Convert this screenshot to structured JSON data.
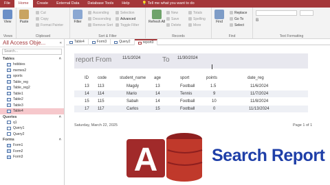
{
  "menubar": {
    "items": [
      "File",
      "Home",
      "Create",
      "External Data",
      "Database Tools",
      "Help"
    ],
    "tell_me": "Tell me what you want to do",
    "colors": {
      "bar": "#a4373a"
    }
  },
  "ribbon": {
    "views": {
      "label": "View",
      "group": "Views"
    },
    "clipboard": {
      "paste": "Paste",
      "cut": "Cut",
      "copy": "Copy",
      "painter": "Format Painter",
      "group": "Clipboard"
    },
    "sort": {
      "filter": "Filter",
      "asc": "Ascending",
      "desc": "Descending",
      "remove": "Remove Sort",
      "selection": "Selection",
      "advanced": "Advanced",
      "toggle": "Toggle Filter",
      "group": "Sort & Filter"
    },
    "records": {
      "refresh": "Refresh All",
      "new": "New",
      "save": "Save",
      "delete": "Delete",
      "totals": "Totals",
      "spelling": "Spelling",
      "more": "More",
      "group": "Records"
    },
    "find": {
      "find": "Find",
      "replace": "Replace",
      "goto": "Go To",
      "select": "Select",
      "group": "Find"
    },
    "text": {
      "group": "Text Formatting"
    }
  },
  "nav": {
    "title": "All Access Obje...",
    "search_placeholder": "Search...",
    "tables_header": "Tables",
    "tables": [
      "hobbies",
      "memes2",
      "sports",
      "Table_reg",
      "Table_reg2",
      "Table1",
      "Table2",
      "Table3",
      "Table4"
    ],
    "queries_header": "Queries",
    "queries": [
      "q1",
      "Query1",
      "Query2"
    ],
    "forms_header": "Forms",
    "forms": [
      "Form1",
      "Form2",
      "Form3"
    ]
  },
  "tabs": [
    "Table4",
    "Form3",
    "Query2",
    "report3"
  ],
  "report": {
    "from_label": "report From",
    "from_value": "11/1/2024",
    "to_label": "To",
    "to_value": "11/30/2024",
    "columns": [
      "ID",
      "code",
      "student_name",
      "age",
      "sport",
      "points",
      "date_reg"
    ],
    "rows": [
      [
        "13",
        "113",
        "Magdy",
        "13",
        "Football",
        "1.5",
        "11/6/2024"
      ],
      [
        "14",
        "114",
        "Mario",
        "14",
        "Tennis",
        "9",
        "11/7/2024"
      ],
      [
        "15",
        "115",
        "Sabah",
        "14",
        "Football",
        "10",
        "11/8/2024"
      ],
      [
        "17",
        "117",
        "Carlos",
        "15",
        "Football",
        "0",
        "11/13/2024"
      ]
    ],
    "footer_date": "Saturday, March 22, 2025",
    "footer_page": "Page 1 of 1"
  },
  "overlay": {
    "logo_letter": "A",
    "title": "Search Report",
    "colors": {
      "logo": "#c0392b",
      "title": "#1f3fa8"
    }
  }
}
